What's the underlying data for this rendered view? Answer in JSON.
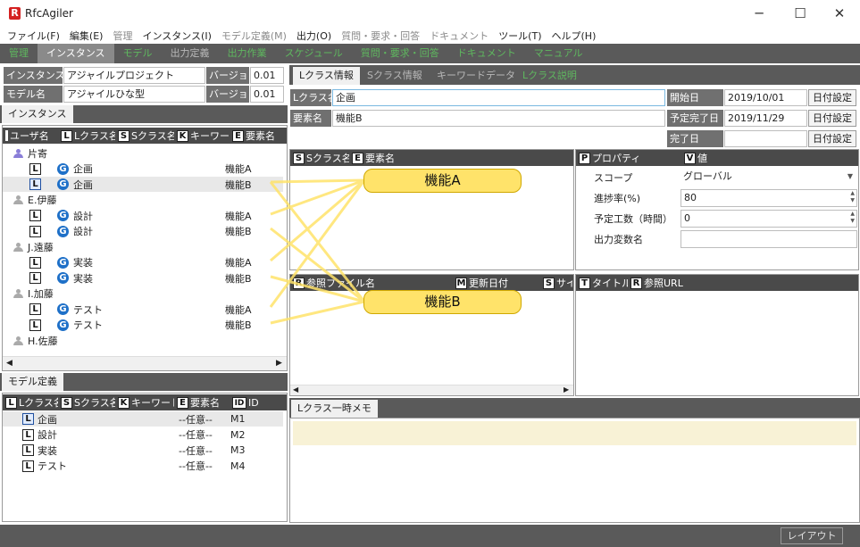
{
  "window": {
    "title": "RfcAgiler",
    "logo": "R",
    "minimize": "─",
    "maximize": "☐",
    "close": "✕"
  },
  "menu": [
    {
      "label": "ファイル(F)",
      "enabled": true
    },
    {
      "label": "編集(E)",
      "enabled": true
    },
    {
      "label": "管理",
      "enabled": false
    },
    {
      "label": "インスタンス(I)",
      "enabled": true
    },
    {
      "label": "モデル定義(M)",
      "enabled": false
    },
    {
      "label": "出力(O)",
      "enabled": true
    },
    {
      "label": "質問・要求・回答",
      "enabled": false
    },
    {
      "label": "ドキュメント",
      "enabled": false
    },
    {
      "label": "ツール(T)",
      "enabled": true
    },
    {
      "label": "ヘルプ(H)",
      "enabled": true
    }
  ],
  "main_tabs": [
    "管理",
    "インスタンス",
    "モデル",
    "出力定義",
    "出力作業",
    "スケジュール",
    "質問・要求・回答",
    "ドキュメント",
    "マニュアル"
  ],
  "instance_info": {
    "instance_label": "インスタンス名",
    "instance_value": "アジャイルプロジェクト",
    "version_label": "バージョン",
    "version_value": "0.01",
    "model_label": "モデル名",
    "model_value": "アジャイルひな型",
    "model_version_label": "バージョン",
    "model_version_value": "0.01"
  },
  "left_tab": "インスタンス",
  "instance_grid": {
    "headers": [
      {
        "icon": "",
        "label": "ユーザ名"
      },
      {
        "icon": "L",
        "label": "Lクラス名"
      },
      {
        "icon": "S",
        "label": "Sクラス名"
      },
      {
        "icon": "K",
        "label": "キーワード"
      },
      {
        "icon": "E",
        "label": "要素名"
      }
    ],
    "users": [
      {
        "name": "片寄",
        "rows": [
          {
            "icon": "G",
            "class": "企画",
            "element": "機能A"
          },
          {
            "icon": "G",
            "class": "企画",
            "element": "機能B"
          }
        ]
      },
      {
        "name": "E.伊藤",
        "rows": [
          {
            "icon": "G",
            "class": "設計",
            "element": "機能A"
          },
          {
            "icon": "G",
            "class": "設計",
            "element": "機能B"
          }
        ]
      },
      {
        "name": "J.遠藤",
        "rows": [
          {
            "icon": "G",
            "class": "実装",
            "element": "機能A"
          },
          {
            "icon": "G",
            "class": "実装",
            "element": "機能B"
          }
        ]
      },
      {
        "name": "I.加藤",
        "rows": [
          {
            "icon": "G",
            "class": "テスト",
            "element": "機能A"
          },
          {
            "icon": "G",
            "class": "テスト",
            "element": "機能B"
          }
        ]
      },
      {
        "name": "H.佐藤",
        "rows": []
      }
    ]
  },
  "model_tab": "モデル定義",
  "model_grid": {
    "headers": [
      {
        "icon": "L",
        "label": "Lクラス名"
      },
      {
        "icon": "S",
        "label": "Sクラス名"
      },
      {
        "icon": "K",
        "label": "キーワード"
      },
      {
        "icon": "E",
        "label": "要素名"
      },
      {
        "icon": "ID",
        "label": "ID"
      }
    ],
    "rows": [
      {
        "class": "企画",
        "element": "--任意--",
        "id": "M1"
      },
      {
        "class": "設計",
        "element": "--任意--",
        "id": "M2"
      },
      {
        "class": "実装",
        "element": "--任意--",
        "id": "M3"
      },
      {
        "class": "テスト",
        "element": "--任意--",
        "id": "M4"
      }
    ]
  },
  "right_tabs": [
    "Lクラス情報",
    "Sクラス情報",
    "キーワードデータ",
    "Lクラス説明"
  ],
  "lclass_form": {
    "class_label": "Lクラス名",
    "class_value": "企画",
    "element_label": "要素名",
    "element_value": "機能B",
    "start_label": "開始日",
    "start_value": "2019/10/01",
    "planned_end_label": "予定完了日",
    "planned_end_value": "2019/11/29",
    "end_label": "完了日",
    "end_value": "",
    "date_button": "日付設定"
  },
  "sclass_grid": {
    "headers": [
      {
        "icon": "S",
        "label": "Sクラス名"
      },
      {
        "icon": "E",
        "label": "要素名"
      }
    ]
  },
  "property_grid": {
    "headers": [
      {
        "icon": "P",
        "label": "プロパティ"
      },
      {
        "icon": "V",
        "label": "値"
      }
    ],
    "rows": [
      {
        "name": "スコープ",
        "value": "グローバル"
      },
      {
        "name": "進捗率(%)",
        "value": "80"
      },
      {
        "name": "予定工数（時間）",
        "value": "0"
      },
      {
        "name": "出力変数名",
        "value": ""
      }
    ]
  },
  "ref_grid": {
    "headers": [
      {
        "icon": "R",
        "label": "参照ファイル名"
      },
      {
        "icon": "M",
        "label": "更新日付"
      },
      {
        "icon": "S",
        "label": "サイ"
      }
    ]
  },
  "url_grid": {
    "headers": [
      {
        "icon": "T",
        "label": "タイトル"
      },
      {
        "icon": "R",
        "label": "参照URL"
      }
    ]
  },
  "memo_tab": "Lクラス一時メモ",
  "callouts": [
    "機能A",
    "機能B"
  ],
  "status_button": "レイアウト",
  "colors": {
    "accent_green": "#5fb85f",
    "callout_yellow": "#ffe36a",
    "memo_bg": "#f8f2d6"
  }
}
